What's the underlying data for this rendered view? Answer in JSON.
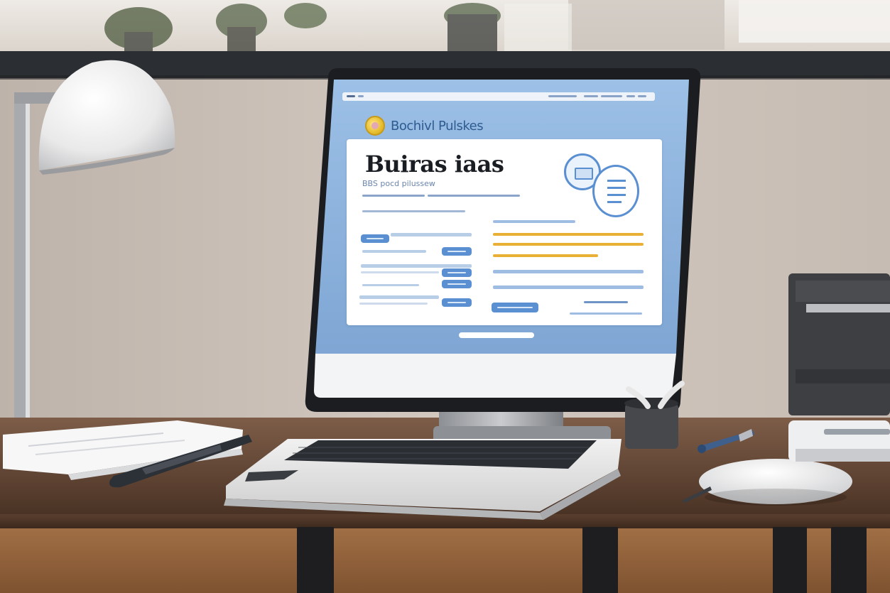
{
  "screen": {
    "brand_name": "Bochivl Pulskes",
    "headline": "Buiras iaas",
    "subtitle": "BBS pocd pilussew"
  },
  "colors": {
    "wall": "#cfc5bd",
    "shelf": "#2a2d31",
    "desk": "#6b4e3b",
    "screen_blue": "#8fb3dd",
    "accent_yellow": "#e9b036",
    "accent_blue": "#5a8fd1"
  },
  "icons": {
    "brand_logo": "coin-logo-icon",
    "document_badge": "document-icon",
    "id_badge": "id-card-icon"
  }
}
